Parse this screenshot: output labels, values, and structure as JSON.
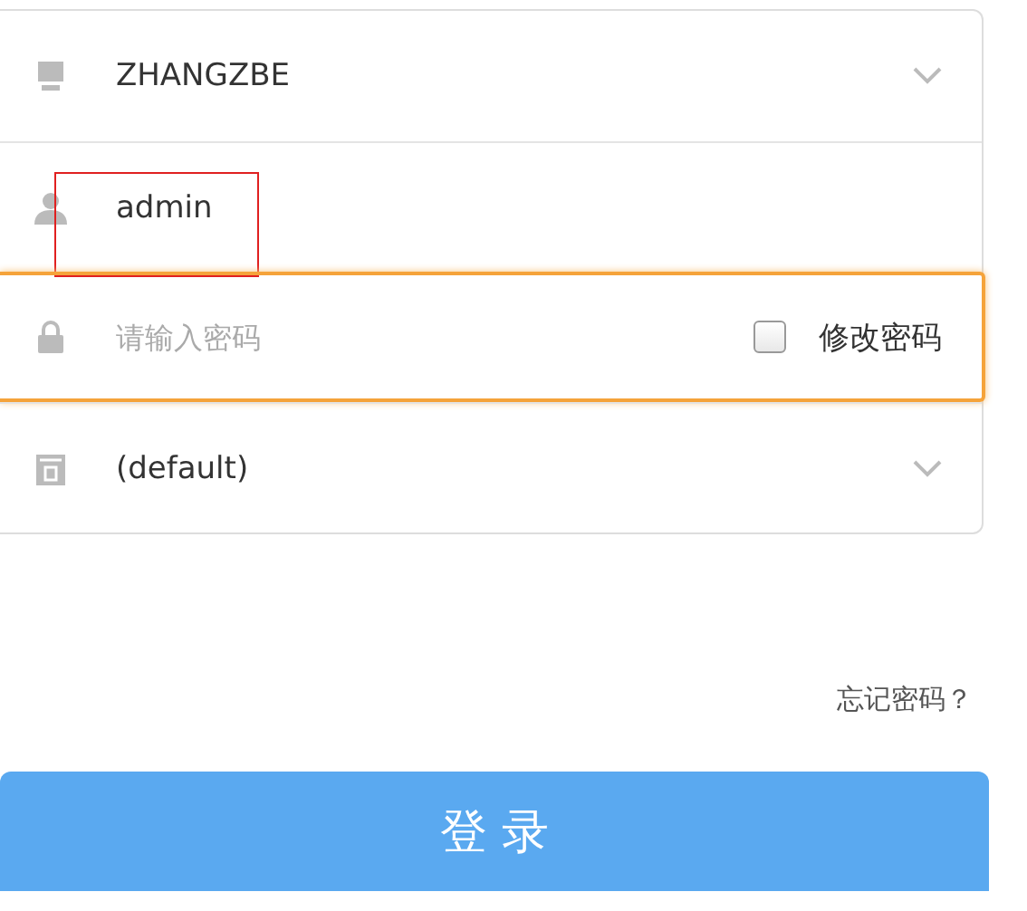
{
  "fields": [
    {
      "kind": "select",
      "value": "ZHANGZBE",
      "focused": false,
      "highlighted": false
    },
    {
      "kind": "text",
      "value": "admin",
      "focused": false,
      "highlighted": true
    },
    {
      "kind": "password",
      "placeholder": "请输入密码",
      "focused": true,
      "highlighted": false,
      "checkbox": {
        "label": "修改密码",
        "checked": false
      }
    },
    {
      "kind": "select",
      "value": "(default)",
      "focused": false,
      "highlighted": false
    }
  ],
  "forgot_link": "忘记密码？",
  "login_button": "登 录"
}
